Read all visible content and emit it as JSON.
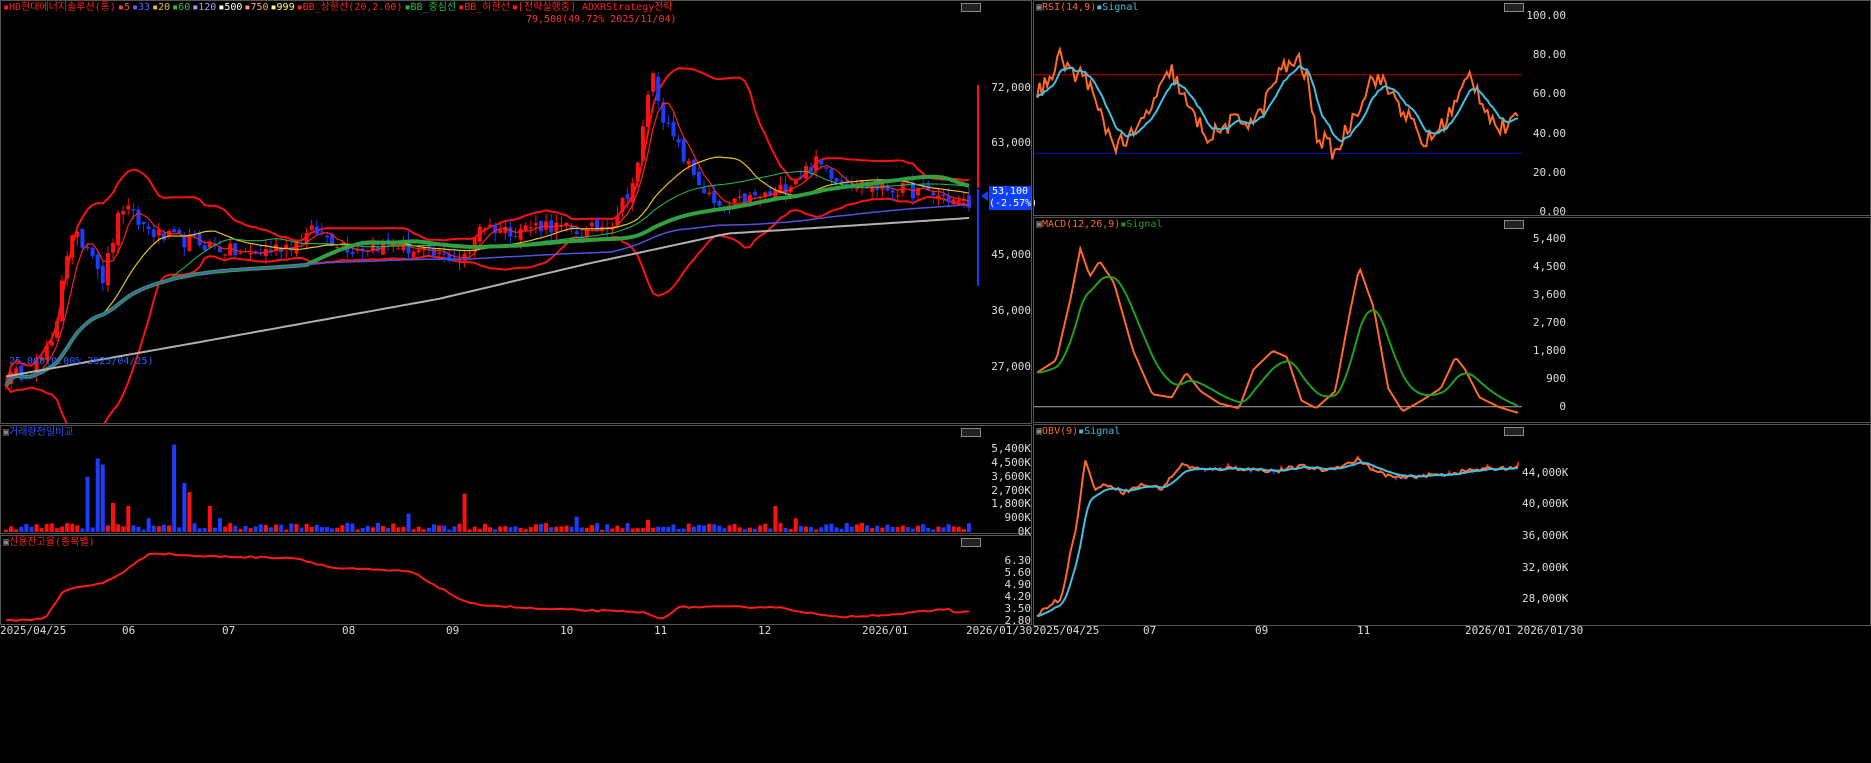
{
  "colors": {
    "up": "#ff1010",
    "down": "#1e3cff",
    "ma5": "#ff2020",
    "ma20": "#e8c020",
    "ma60": "#30a040",
    "ma120": "#5050e0",
    "ma999": "#b0b0b0",
    "rsi": "#ff6a2a",
    "signal": "#40c0e0",
    "macd": "#ff6a2a",
    "macdSignal": "#20a020",
    "obv": "#ff6a2a",
    "obvSignal": "#40c0e0",
    "credit": "#ff1a1a",
    "hline_up": "#c00000",
    "hline_dn": "#1010c0"
  },
  "price_panel": {
    "legend": [
      "HD현대에너지솔루션(통)",
      "5",
      "33",
      "20",
      "60",
      "120",
      "500",
      "750",
      "999",
      "BB_상한선(20,2.00)",
      "BB_중심선",
      "BB_하한선",
      "[전략실행중] ADXRStrategy전략"
    ],
    "annotation": "79,500(49.72% 2025/11/04)",
    "low_annotation": "25,000(0.00% 2025/04/25)",
    "current_price": "53,100",
    "current_change": "(-2.57%)"
  },
  "volume_panel": {
    "title": "거래량전일비교"
  },
  "credit_panel": {
    "title": "신용잔고율(종목별)"
  },
  "rsi_panel": {
    "title": "RSI(14,9)",
    "signal_label": "Signal"
  },
  "macd_panel": {
    "title": "MACD(12,26,9)",
    "signal_label": "Signal"
  },
  "obv_panel": {
    "title": "OBV(9)",
    "signal_label": "Signal"
  },
  "dates_left": [
    "2025/04/25",
    "06",
    "07",
    "08",
    "09",
    "10",
    "11",
    "12",
    "2026/01",
    "2026/01/30"
  ],
  "dates_right": [
    "2025/04/25",
    "07",
    "09",
    "11",
    "2026/01",
    "2026/01/30"
  ],
  "chart_data": [
    {
      "type": "line",
      "name": "price",
      "ylabels": [
        "72,000",
        "63,000",
        "54,000",
        "45,000",
        "36,000",
        "27,000"
      ],
      "ylim": [
        18000,
        84000
      ],
      "x": [
        "2025/04/25",
        "2025/06",
        "2025/07",
        "2025/08",
        "2025/09",
        "2025/10",
        "2025/11",
        "2025/12",
        "2026/01",
        "2026/01/30"
      ],
      "series": [
        {
          "values": [
            25000,
            44000,
            47000,
            45000,
            44500,
            49000,
            67000,
            56000,
            55000,
            53100
          ]
        }
      ]
    },
    {
      "type": "bar",
      "name": "volume",
      "ylabels": [
        "5,400K",
        "4,500K",
        "3,600K",
        "2,700K",
        "1,800K",
        "900K",
        "0K"
      ],
      "ylim": [
        0,
        6000
      ]
    },
    {
      "type": "line",
      "name": "credit",
      "ylabels": [
        "6.30",
        "5.60",
        "4.90",
        "4.20",
        "3.50",
        "2.80"
      ],
      "ylim": [
        2.6,
        7.2
      ],
      "x": [
        "2025/04/25",
        "2025/06",
        "2025/07",
        "2025/08",
        "2025/09",
        "2025/10",
        "2025/11",
        "2025/12",
        "2026/01",
        "2026/01/30"
      ],
      "series": [
        {
          "values": [
            2.9,
            5.6,
            6.8,
            6.5,
            5.9,
            3.8,
            3.4,
            3.5,
            3.3,
            3.4
          ]
        }
      ]
    },
    {
      "type": "line",
      "name": "rsi",
      "ylabels": [
        "100.00",
        "80.00",
        "60.00",
        "40.00",
        "20.00",
        "0.00"
      ],
      "ylim": [
        0,
        100
      ],
      "hlines": [
        70,
        30
      ]
    },
    {
      "type": "line",
      "name": "macd",
      "ylabels": [
        "5,400",
        "4,500",
        "3,600",
        "2,700",
        "1,800",
        "900",
        "0"
      ],
      "ylim": [
        -300,
        5700
      ]
    },
    {
      "type": "line",
      "name": "obv",
      "ylabels": [
        "44,000K",
        "40,000K",
        "36,000K",
        "32,000K",
        "28,000K"
      ],
      "ylim": [
        25000,
        48500
      ]
    }
  ]
}
